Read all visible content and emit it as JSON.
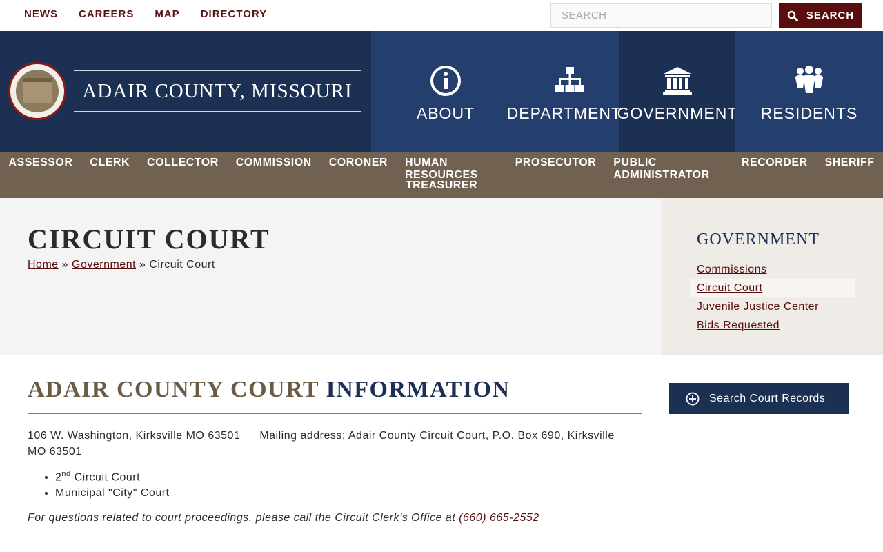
{
  "topbar": {
    "links": [
      "NEWS",
      "CAREERS",
      "MAP",
      "DIRECTORY"
    ],
    "search_placeholder": "SEARCH",
    "search_button": "SEARCH"
  },
  "header": {
    "site_title": "ADAIR COUNTY, MISSOURI",
    "logo_icon": "county-seal-icon",
    "nav": [
      {
        "label": "ABOUT",
        "icon": "info-circle-icon"
      },
      {
        "label": "DEPARTMENTS",
        "icon": "sitemap-icon"
      },
      {
        "label": "GOVERNMENT",
        "icon": "courthouse-icon"
      },
      {
        "label": "RESIDENTS",
        "icon": "people-icon"
      }
    ],
    "active_nav": "GOVERNMENT"
  },
  "subnav": {
    "row1": [
      "ASSESSOR",
      "CLERK",
      "COLLECTOR",
      "COMMISSION",
      "CORONER",
      "HUMAN RESOURCES",
      "PROSECUTOR",
      "PUBLIC ADMINISTRATOR",
      "RECORDER",
      "SHERIFF"
    ],
    "row2": [
      "TREASURER"
    ]
  },
  "page": {
    "title": "CIRCUIT COURT",
    "breadcrumb": {
      "home": "Home",
      "sep": "»",
      "parent": "Government",
      "current": "Circuit Court"
    }
  },
  "sidebar": {
    "heading": "GOVERNMENT",
    "links": [
      "Commissions",
      "Circuit Court",
      "Juvenile Justice Center",
      "Bids Requested"
    ],
    "current": "Circuit Court"
  },
  "content": {
    "heading_part1": "ADAIR COUNTY COURT ",
    "heading_part2": "INFORMATION",
    "address": "106 W. Washington, Kirksville MO 63501",
    "mailing": "Mailing address:  Adair County Circuit Court, P.O. Box 690, Kirksville MO 63501",
    "courts": [
      {
        "num": "2",
        "sup": "nd",
        "text": " Circuit Court"
      },
      {
        "text": "Municipal \"City\" Court"
      }
    ],
    "phone_text": "For questions related to court proceedings, please call the Circuit Clerk’s Office at ",
    "phone": "(660) 665-2552"
  },
  "records_button": {
    "label": "Search Court Records",
    "icon": "plus-circle-icon"
  },
  "colors": {
    "navy": "#1c3054",
    "nav_blue": "#243f6e",
    "maroon": "#5a0d0d",
    "brown": "#706150"
  }
}
